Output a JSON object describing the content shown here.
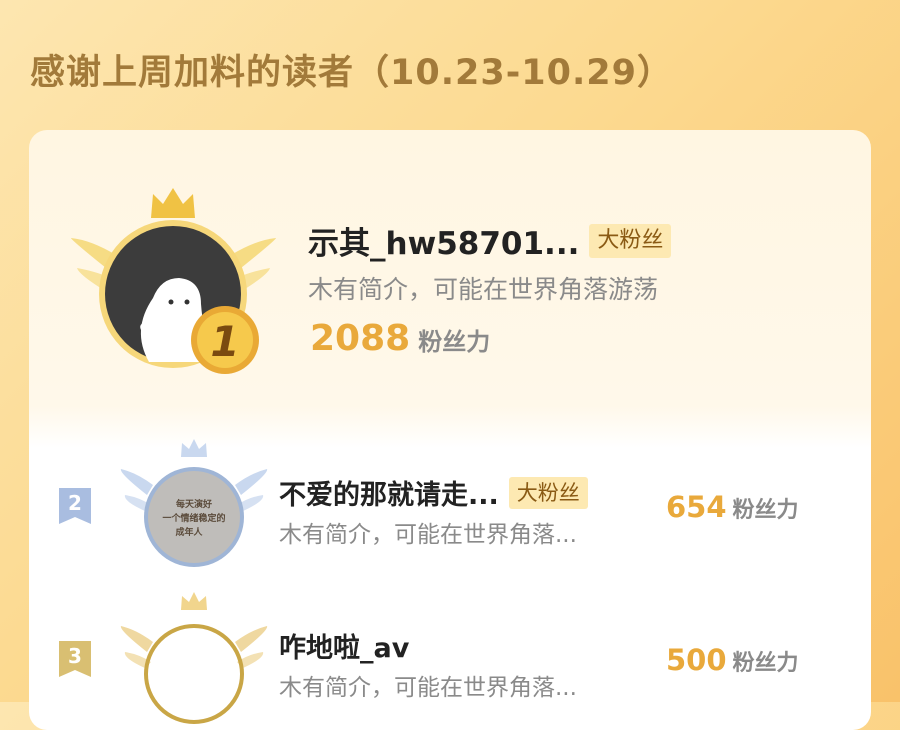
{
  "title": "感谢上周加料的读者（10.23-10.29）",
  "top_fan": {
    "rank": "1",
    "name": "示其_hw58701...",
    "tag": "大粉丝",
    "bio": "木有简介，可能在世界角落游荡",
    "score": "2088",
    "score_unit": "粉丝力"
  },
  "fans": [
    {
      "rank": "2",
      "name": "不爱的那就请走...",
      "tag": "大粉丝",
      "bio": "木有简介，可能在世界角落...",
      "score": "654",
      "score_unit": "粉丝力",
      "avatar_text": [
        "每天演好",
        "一个情绪稳定的",
        "成年人"
      ]
    },
    {
      "rank": "3",
      "name": "咋地啦_av",
      "bio": "木有简介，可能在世界角落...",
      "score": "500",
      "score_unit": "粉丝力"
    }
  ],
  "colors": {
    "accent": "#e9a93b",
    "gold": "#f0c244",
    "silver": "#9fb5d6",
    "bronze": "#d9bf72"
  }
}
